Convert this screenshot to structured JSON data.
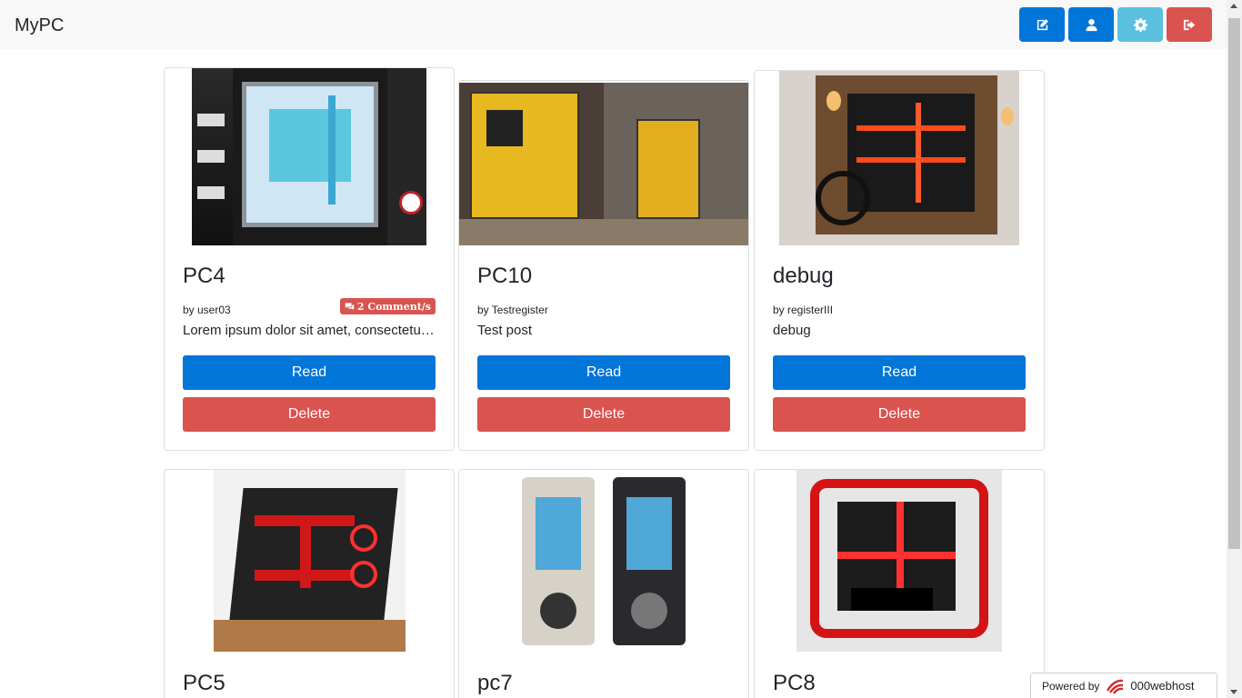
{
  "app": {
    "title": "MyPC"
  },
  "nav": {
    "buttons": [
      {
        "icon": "edit-icon",
        "color": "#0275d8"
      },
      {
        "icon": "user-icon",
        "color": "#0275d8"
      },
      {
        "icon": "gear-icon",
        "color": "#5bc0de"
      },
      {
        "icon": "logout-icon",
        "color": "#d9534f"
      }
    ]
  },
  "posts": [
    {
      "title": "PC4",
      "author": "by user03",
      "excerpt": "Lorem ipsum dolor sit amet, consectetur adipiscing elit",
      "comments": "2 Comment/s",
      "read_label": "Read",
      "delete_label": "Delete"
    },
    {
      "title": "PC10",
      "author": "by Testregister",
      "excerpt": "Test post",
      "read_label": "Read",
      "delete_label": "Delete"
    },
    {
      "title": "debug",
      "author": "by registerIII",
      "excerpt": "debug",
      "read_label": "Read",
      "delete_label": "Delete"
    },
    {
      "title": "PC5"
    },
    {
      "title": "pc7"
    },
    {
      "title": "PC8"
    }
  ],
  "footer_badge": {
    "prefix": "Powered by",
    "host": "000webhost"
  },
  "colors": {
    "primary": "#0275d8",
    "danger": "#d9534f",
    "info": "#5bc0de",
    "navbar_bg": "#f8f8f8"
  }
}
